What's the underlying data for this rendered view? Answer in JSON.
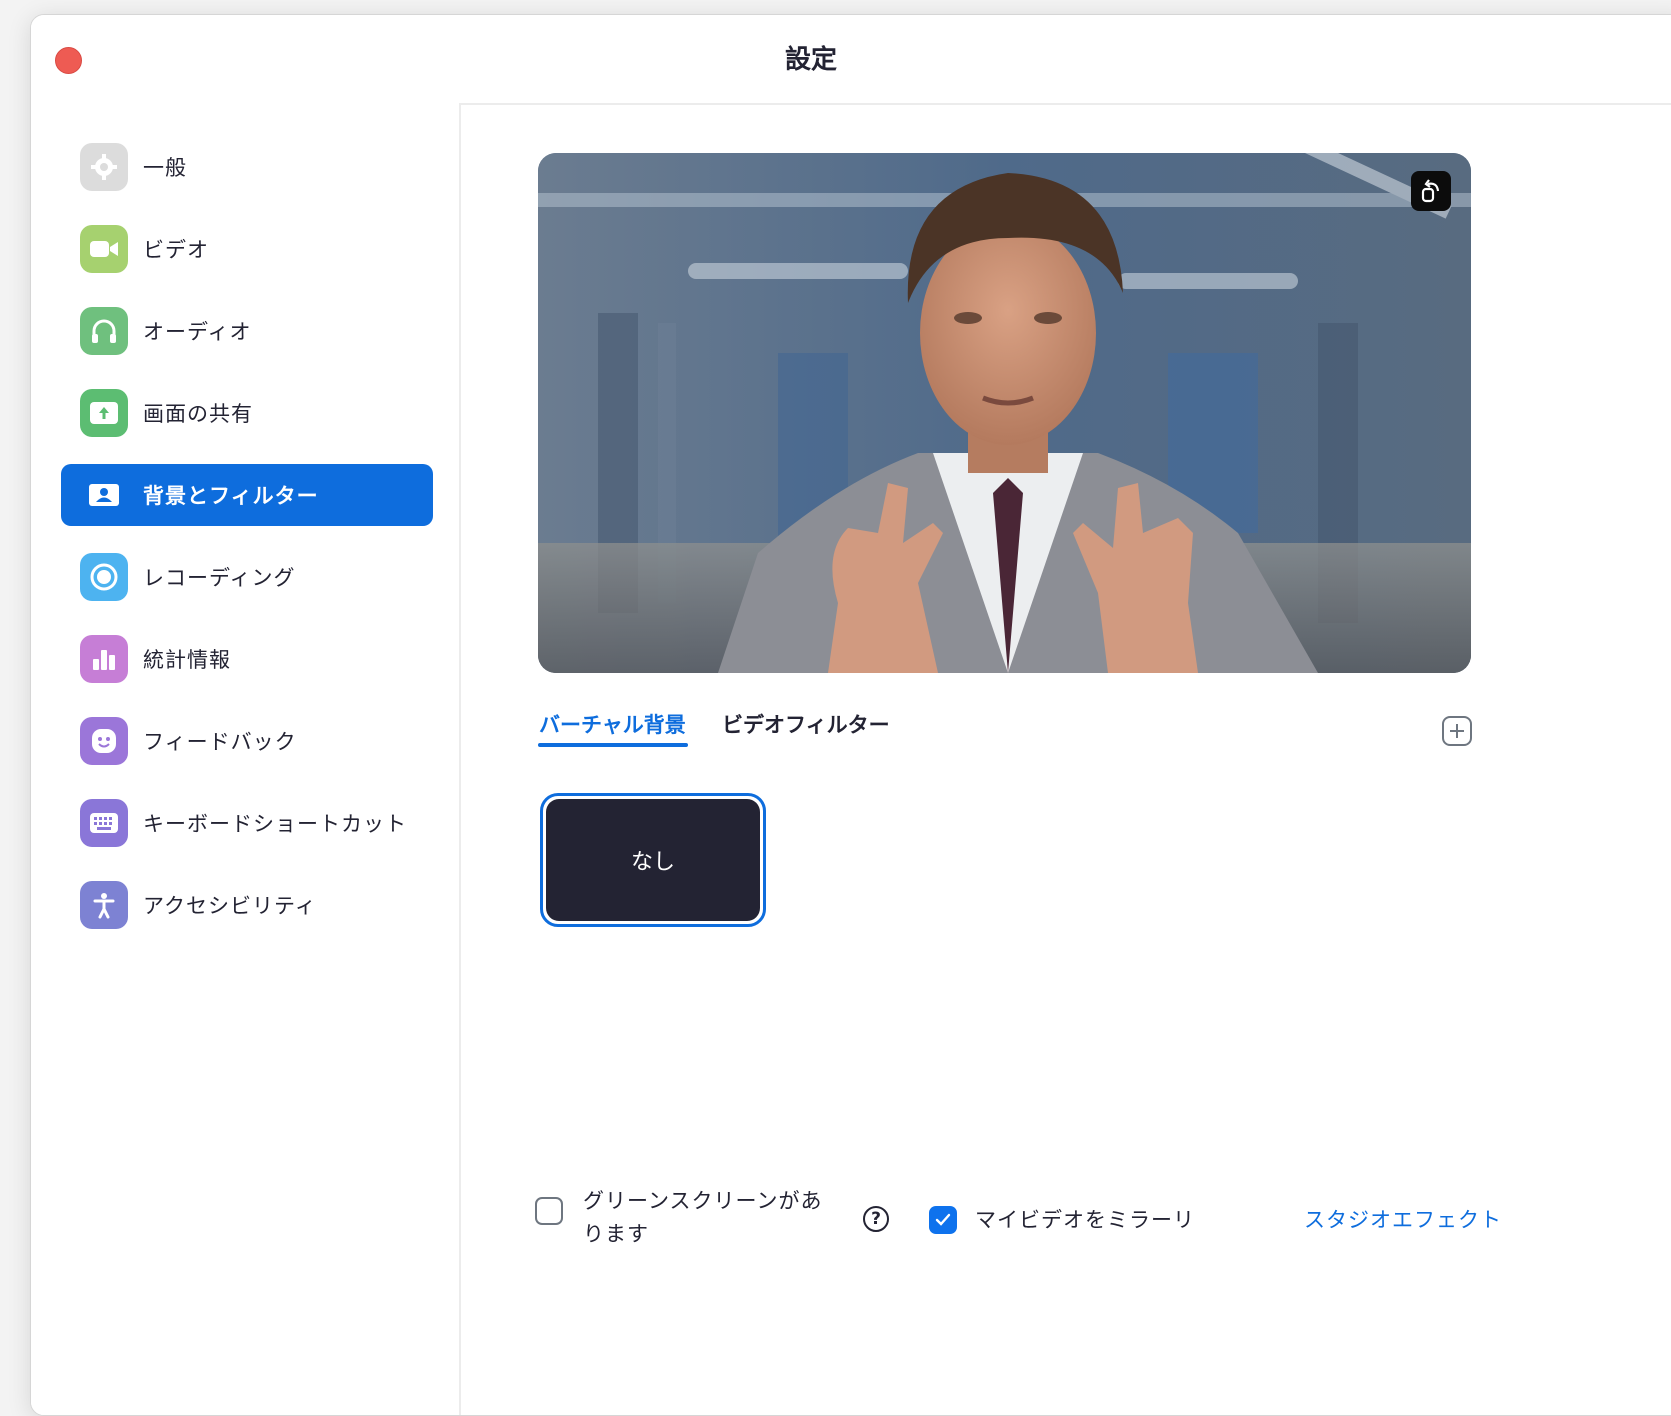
{
  "window": {
    "title": "設定"
  },
  "sidebar": {
    "items": [
      {
        "label": "一般",
        "icon": "gear-icon",
        "color": "#dcdcdc",
        "active": false
      },
      {
        "label": "ビデオ",
        "icon": "video-camera-icon",
        "color": "#a6d16f",
        "active": false
      },
      {
        "label": "オーディオ",
        "icon": "headphones-icon",
        "color": "#6fc07e",
        "active": false
      },
      {
        "label": "画面の共有",
        "icon": "share-screen-icon",
        "color": "#5cbd72",
        "active": false
      },
      {
        "label": "背景とフィルター",
        "icon": "background-portrait-icon",
        "color": "#0e6ddd",
        "active": true
      },
      {
        "label": "レコーディング",
        "icon": "record-icon",
        "color": "#4db3f0",
        "active": false
      },
      {
        "label": "統計情報",
        "icon": "statistics-icon",
        "color": "#c67ed6",
        "active": false
      },
      {
        "label": "フィードバック",
        "icon": "feedback-smiley-icon",
        "color": "#9b76d9",
        "active": false
      },
      {
        "label": "キーボードショートカット",
        "icon": "keyboard-icon",
        "color": "#8a76d8",
        "active": false
      },
      {
        "label": "アクセシビリティ",
        "icon": "accessibility-icon",
        "color": "#7d82d3",
        "active": false
      }
    ]
  },
  "tabs": [
    {
      "label": "バーチャル背景",
      "active": true
    },
    {
      "label": "ビデオフィルター",
      "active": false
    }
  ],
  "backgrounds": {
    "none_label": "なし"
  },
  "bottom": {
    "green_screen_label_line1": "グリーンスクリーンがあ",
    "green_screen_label_line2": "ります",
    "green_screen_checked": false,
    "mirror_label": "マイビデオをミラーリ",
    "mirror_checked": true,
    "studio_effects": "スタジオエフェクト"
  },
  "colors": {
    "accent": "#0e6ddd",
    "close": "#ee5b53"
  }
}
